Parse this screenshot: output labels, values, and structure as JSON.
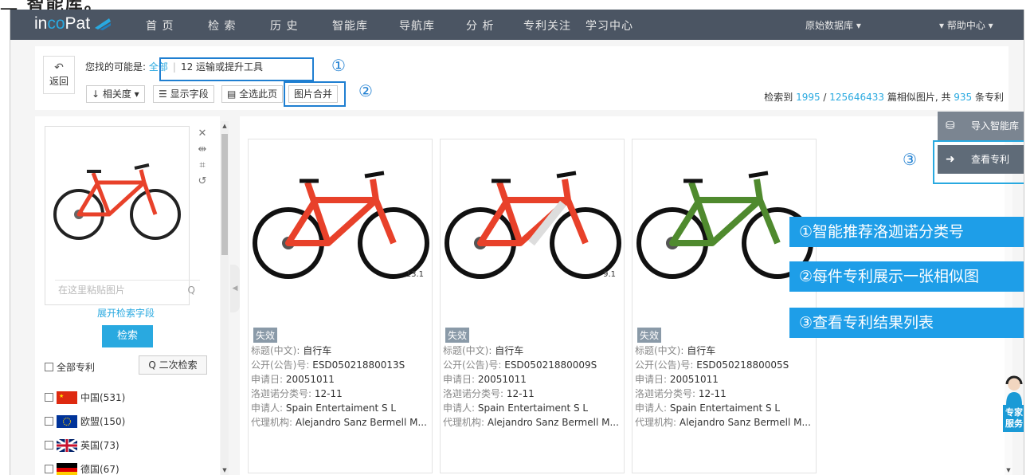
{
  "top_clipped_text": "二 智能库。",
  "nav": {
    "logo_pre": "in",
    "logo_co": "co",
    "logo_post": "Pat",
    "items": [
      "首 页",
      "检 索",
      "历 史",
      "智能库",
      "导航库",
      "分 析",
      "专利关注",
      "学习中心"
    ],
    "db": "原始数据库 ▾",
    "help": "▾ 帮助中心 ▾"
  },
  "toolbar": {
    "back_arrow": "↶",
    "back_label": "返回",
    "maybe_label": "您找的可能是:",
    "maybe_all": "全部",
    "maybe_sep": "|",
    "maybe_item": "12 运输或提升工具",
    "marker1": "①",
    "sort_label": "↓ 相关度 ▾",
    "fields_label": "☰ 显示字段",
    "select_page_label": "▤ 全选此页",
    "merge_label": "图片合并",
    "marker2": "②",
    "result_pre": "检索到 ",
    "result_count": "1995",
    "result_slash": " / ",
    "result_total": "125646433",
    "result_mid": " 篇相似图片, 共 ",
    "result_patents": "935",
    "result_post": " 条专利"
  },
  "left": {
    "paste_placeholder": "在这里粘贴图片",
    "search_icon": "Q",
    "expand_label": "展开检索字段",
    "search_label": "检索",
    "all_patents": "全部专利",
    "second_search": "Q 二次检索",
    "countries": [
      {
        "name": "中国(531)"
      },
      {
        "name": "欧盟(150)"
      },
      {
        "name": "英国(73)"
      },
      {
        "name": "德国(67)"
      }
    ]
  },
  "cards": [
    {
      "score": "13.1",
      "status": "失效",
      "title_k": "标题(中文): ",
      "title_v": "自行车",
      "pub_k": "公开(公告)号: ",
      "pub_v": "ESD05021880013S",
      "date_k": "申请日: ",
      "date_v": "20051011",
      "loc_k": "洛迦诺分类号: ",
      "loc_v": "12-11",
      "app_k": "申请人: ",
      "app_v": "Spain Entertaiment S L",
      "agent_k": "代理机构: ",
      "agent_v": "Alejandro Sanz Bermell M...",
      "frame_color": "#e8412a"
    },
    {
      "score": "9.1",
      "status": "失效",
      "title_k": "标题(中文): ",
      "title_v": "自行车",
      "pub_k": "公开(公告)号: ",
      "pub_v": "ESD05021880009S",
      "date_k": "申请日: ",
      "date_v": "20051011",
      "loc_k": "洛迦诺分类号: ",
      "loc_v": "12-11",
      "app_k": "申请人: ",
      "app_v": "Spain Entertaiment S L",
      "agent_k": "代理机构: ",
      "agent_v": "Alejandro Sanz Bermell M...",
      "frame_color": "#e8412a"
    },
    {
      "score": "",
      "status": "失效",
      "title_k": "标题(中文): ",
      "title_v": "自行车",
      "pub_k": "公开(公告)号: ",
      "pub_v": "ESD05021880005S",
      "date_k": "申请日: ",
      "date_v": "20051011",
      "loc_k": "洛迦诺分类号: ",
      "loc_v": "12-11",
      "app_k": "申请人: ",
      "app_v": "Spain Entertaiment S L",
      "agent_k": "代理机构: ",
      "agent_v": "Alejandro Sanz Bermell M...",
      "frame_color": "#4f8a2e"
    }
  ],
  "right": {
    "import_label": "导入智能库",
    "view_label": "查看专利",
    "marker3": "③",
    "banner1": "①智能推荐洛迦诺分类号",
    "banner2": "②每件专利展示一张相似图",
    "banner3": "③查看专利结果列表",
    "expert_label": "专家服务"
  },
  "colors": {
    "accent": "#29a9e0",
    "nav_bg": "#4b5563",
    "annotation": "#1f7fd1",
    "banner": "#1e9ee8"
  }
}
